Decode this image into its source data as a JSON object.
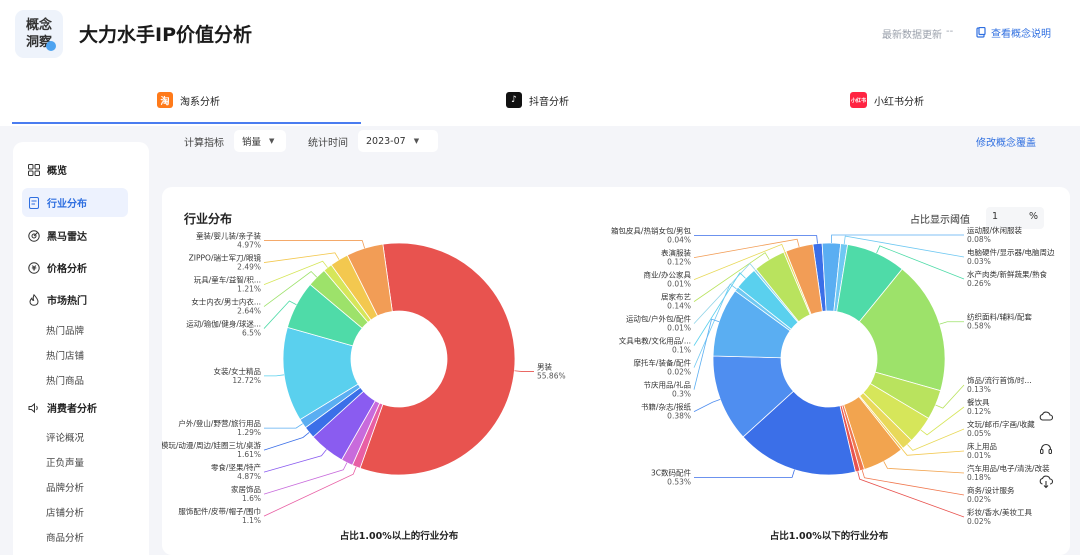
{
  "header": {
    "logo_line1": "概念",
    "logo_line2": "洞察",
    "title": "大力水手IP价值分析",
    "update_label": "最新数据更新",
    "update_value": "--",
    "help_link": "查看概念说明"
  },
  "tabs": [
    {
      "label": "淘系分析",
      "icon_text": "淘",
      "color": "#ff7a1a"
    },
    {
      "label": "抖音分析",
      "icon_text": "♪",
      "color": "#111111"
    },
    {
      "label": "小红书分析",
      "icon_text": "小红书",
      "color": "#ff2442"
    }
  ],
  "sidebar": {
    "overview": "概览",
    "industry": "行业分布",
    "darkhorse": "黑马雷达",
    "price": "价格分析",
    "market": "市场热门",
    "market_subs": [
      "热门品牌",
      "热门店铺",
      "热门商品"
    ],
    "consumer": "消费者分析",
    "consumer_subs": [
      "评论概况",
      "正负声量",
      "品牌分析",
      "店铺分析",
      "商品分析"
    ]
  },
  "filters": {
    "metric_label": "计算指标",
    "metric_value": "销量",
    "time_label": "统计时间",
    "time_value": "2023-07",
    "modify_link": "修改概念覆盖"
  },
  "card": {
    "title": "行业分布",
    "threshold_label": "占比显示阈值",
    "threshold_value": "1",
    "threshold_unit": "%"
  },
  "chart_data": [
    {
      "type": "pie",
      "title": "占比1.00%以上的行业分布",
      "unit": "%",
      "categories": [
        "男装",
        "服饰配件/皮带/帽子/围巾",
        "家居饰品",
        "零食/坚果/特产",
        "模玩/动漫/周边/娃圈三坑/桌游",
        "户外/登山/野营/旅行用品",
        "女装/女士精品",
        "运动/瑜伽/健身/球迷...",
        "女士内衣/男士内衣...",
        "玩具/童车/益智/积...",
        "ZIPPO/瑞士军刀/眼镜",
        "童装/婴儿装/亲子装"
      ],
      "values": [
        55.86,
        1.1,
        1.6,
        4.87,
        1.61,
        1.29,
        12.72,
        6.5,
        2.64,
        1.21,
        2.49,
        4.97
      ],
      "colors": [
        "#e8534f",
        "#e85fa4",
        "#c86bdc",
        "#8a5cf0",
        "#3b6fe8",
        "#5aaef2",
        "#5ad0ee",
        "#4fdba8",
        "#9de26a",
        "#d6e65a",
        "#f3c84f",
        "#f29d56"
      ],
      "percent_labels": [
        "55.86%",
        "1.1%",
        "1.6%",
        "4.87%",
        "1.61%",
        "1.29%",
        "12.72%",
        "6.5%",
        "2.64%",
        "1.21%",
        "2.49%",
        "4.97%"
      ]
    },
    {
      "type": "pie",
      "title": "占比1.00%以下的行业分布",
      "unit": "%",
      "categories": [
        "箱包皮具/热销女包/男包",
        "运动服/休闲服装",
        "电脑硬件/显示器/电脑周边",
        "水产肉类/新鲜蔬果/熟食",
        "纺织面料/辅料/配套",
        "饰品/流行首饰/时...",
        "餐饮具",
        "文玩/邮币/字画/收藏",
        "床上用品",
        "汽车用品/电子/清洗/改装",
        "商务/设计服务",
        "彩妆/香水/美妆工具",
        "3C数码配件",
        "书籍/杂志/报纸",
        "节庆用品/礼品",
        "摩托车/装备/配件",
        "文具电教/文化用品/...",
        "运动包/户外包/配件",
        "居家布艺",
        "商业/办公家具",
        "表演服装"
      ],
      "values": [
        0.04,
        0.08,
        0.03,
        0.26,
        0.58,
        0.13,
        0.12,
        0.05,
        0.01,
        0.18,
        0.02,
        0.02,
        0.53,
        0.38,
        0.3,
        0.02,
        0.1,
        0.01,
        0.14,
        0.01,
        0.12
      ],
      "colors": [
        "#3b6fe8",
        "#5aaef2",
        "#6fc8f2",
        "#4fdba8",
        "#9de26a",
        "#b9e35e",
        "#d6e65a",
        "#e8d95a",
        "#f3c84f",
        "#f2a44f",
        "#f0784f",
        "#e8534f",
        "#3b6fe8",
        "#4f8ef0",
        "#5aaef2",
        "#6fc8f2",
        "#5ad0ee",
        "#8fd4e8",
        "#b9e35e",
        "#e8d95a",
        "#f29d56"
      ],
      "percent_labels": [
        "0.04%",
        "0.08%",
        "0.03%",
        "0.26%",
        "0.58%",
        "0.13%",
        "0.12%",
        "0.05%",
        "0.01%",
        "0.18%",
        "0.02%",
        "0.02%",
        "0.53%",
        "0.38%",
        "0.3%",
        "0.02%",
        "0.1%",
        "0.01%",
        "0.14%",
        "0.01%",
        "0.12%"
      ]
    }
  ]
}
